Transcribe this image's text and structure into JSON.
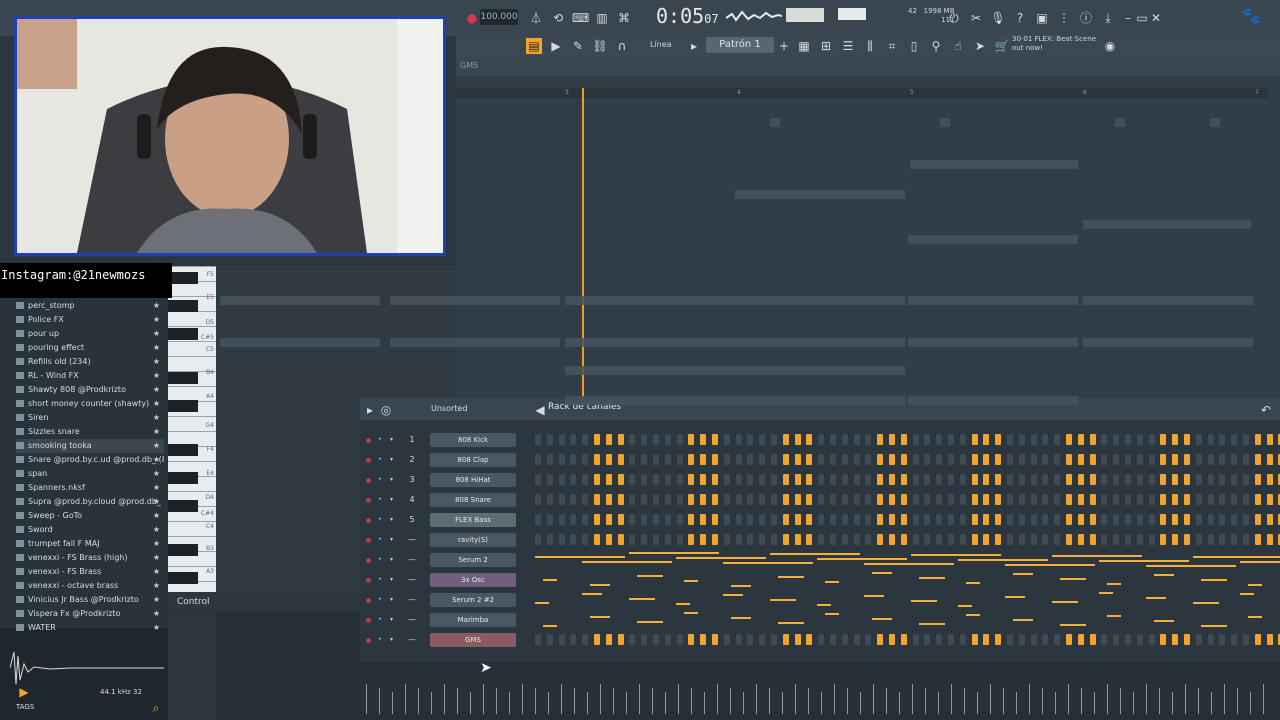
{
  "toolbar": {
    "tempo": "100.000",
    "time": "0:05",
    "time_small": "07",
    "memory": "1998 MB",
    "memory_sub": "111",
    "cpu": "42",
    "pattern": "Patrón 1",
    "snap": "Línea",
    "hint": "30-01  FLEX: Beat Scene out now!"
  },
  "playlist": {
    "tab": "GMS",
    "ruler_numbers": [
      "3",
      "4",
      "5",
      "6",
      "7"
    ]
  },
  "overlay": {
    "instagram": "Instagram:@21newmozs"
  },
  "browser": {
    "items": [
      {
        "label": "perc_stomp",
        "selected": false
      },
      {
        "label": "Police FX",
        "selected": false
      },
      {
        "label": "pour up",
        "selected": false
      },
      {
        "label": "pouring effect",
        "selected": false
      },
      {
        "label": "Refills old (234)",
        "selected": false
      },
      {
        "label": "RL - Wind FX",
        "selected": false
      },
      {
        "label": "Shawty 808 @Prodkrizto",
        "selected": false
      },
      {
        "label": "short money counter (shawty)",
        "selected": false
      },
      {
        "label": "Siren",
        "selected": false
      },
      {
        "label": "Sizzles snare",
        "selected": false
      },
      {
        "label": "smooking tooka",
        "selected": true
      },
      {
        "label": "Snare @prod.by.c.ud @prod.db_ (8)",
        "selected": false
      },
      {
        "label": "span",
        "selected": false
      },
      {
        "label": "Spanners.nksf",
        "selected": false
      },
      {
        "label": "Supra @prod.by.cloud @prod.db_",
        "selected": false
      },
      {
        "label": "Sweep - GoTo",
        "selected": false
      },
      {
        "label": "Sword",
        "selected": false
      },
      {
        "label": "trumpet fall F MAJ",
        "selected": false
      },
      {
        "label": "venexxi - FS Brass (high)",
        "selected": false
      },
      {
        "label": "venexxi - FS Brass",
        "selected": false
      },
      {
        "label": "venexxi - octave brass",
        "selected": false
      },
      {
        "label": "Vinicius Jr Bass @Prodkrizto",
        "selected": false
      },
      {
        "label": "Vispera Fx @Prodkrizto",
        "selected": false
      },
      {
        "label": "WATER",
        "selected": false
      }
    ],
    "sample_rate": "44.1 kHz 32",
    "tags": "TAGS"
  },
  "piano": {
    "labels": [
      "F5",
      "E5",
      "D5",
      "C#5",
      "C5",
      "B4",
      "A4",
      "G4",
      "F4",
      "E4",
      "D4",
      "C#4",
      "C4",
      "B3",
      "A3"
    ]
  },
  "control": {
    "label": "Control"
  },
  "rack": {
    "title": "Rack de canales",
    "filter": "Unsorted",
    "channels": [
      {
        "num": "1",
        "name": "808 Kick",
        "style": "",
        "kind": "steps"
      },
      {
        "num": "2",
        "name": "808 Clap",
        "style": "",
        "kind": "steps"
      },
      {
        "num": "3",
        "name": "808 HiHat",
        "style": "",
        "kind": "steps"
      },
      {
        "num": "4",
        "name": "808 Snare",
        "style": "",
        "kind": "steps"
      },
      {
        "num": "5",
        "name": "FLEX Bass",
        "style": "hi",
        "kind": "steps"
      },
      {
        "num": "—",
        "name": "ravity(S)",
        "style": "",
        "kind": "steps"
      },
      {
        "num": "—",
        "name": "Serum 2",
        "style": "",
        "kind": "roll"
      },
      {
        "num": "—",
        "name": "3x Osc",
        "style": "pu",
        "kind": "roll"
      },
      {
        "num": "—",
        "name": "Serum 2 #2",
        "style": "",
        "kind": "roll"
      },
      {
        "num": "—",
        "name": "Marimba",
        "style": "",
        "kind": "roll"
      },
      {
        "num": "—",
        "name": "GMS",
        "style": "pk",
        "kind": "steps"
      }
    ]
  },
  "colors": {
    "accent": "#f2a52e",
    "playhead": "#f39c1f",
    "step_off": "#3e4b55"
  }
}
